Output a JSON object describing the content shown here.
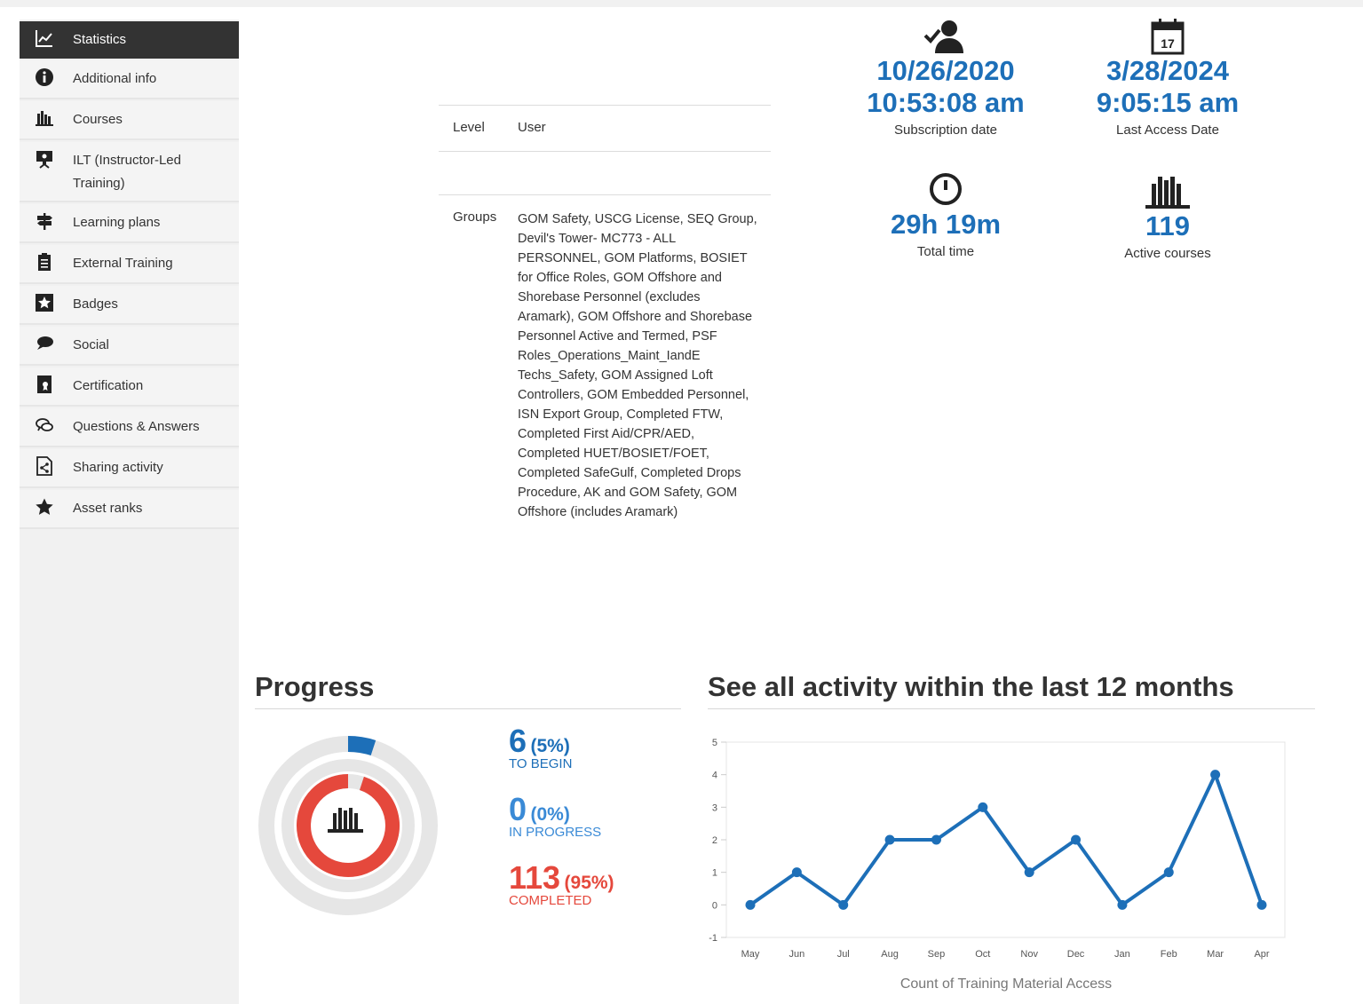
{
  "sidebar": {
    "items": [
      {
        "label": "Statistics",
        "icon": "chart-line-icon",
        "active": true
      },
      {
        "label": "Additional info",
        "icon": "info-icon"
      },
      {
        "label": "Courses",
        "icon": "courses-icon"
      },
      {
        "label": "ILT (Instructor-Led Training)",
        "icon": "presentation-icon"
      },
      {
        "label": "Learning plans",
        "icon": "signpost-icon"
      },
      {
        "label": "External Training",
        "icon": "clipboard-icon"
      },
      {
        "label": "Badges",
        "icon": "badge-star-icon"
      },
      {
        "label": "Social",
        "icon": "chat-bubble-icon"
      },
      {
        "label": "Certification",
        "icon": "certificate-icon"
      },
      {
        "label": "Questions & Answers",
        "icon": "qa-bubbles-icon"
      },
      {
        "label": "Sharing activity",
        "icon": "share-document-icon"
      },
      {
        "label": "Asset ranks",
        "icon": "star-icon"
      }
    ]
  },
  "info": {
    "level_label": "Level",
    "level_value": "User",
    "groups_label": "Groups",
    "groups_value": "GOM Safety, USCG License, SEQ Group, Devil's Tower- MC773 - ALL PERSONNEL, GOM Platforms, BOSIET for Office Roles, GOM Offshore and Shorebase Personnel (excludes Aramark), GOM Offshore and Shorebase Personnel Active and Termed, PSF Roles_Operations_Maint_IandE Techs_Safety, GOM Assigned Loft Controllers, GOM Embedded Personnel, ISN Export Group, Completed FTW, Completed First Aid/CPR/AED, Completed HUET/BOSIET/FOET, Completed SafeGulf, Completed Drops Procedure, AK and GOM Safety, GOM Offshore (includes Aramark)"
  },
  "stats": {
    "subscription": {
      "date": "10/26/2020",
      "time": "10:53:08 am",
      "caption": "Subscription date",
      "icon": "user-check-icon"
    },
    "last_access": {
      "date": "3/28/2024",
      "time": "9:05:15 am",
      "caption": "Last Access Date",
      "icon": "calendar-icon",
      "calendar_day": "17"
    },
    "total_time": {
      "value": "29h 19m",
      "caption": "Total time",
      "icon": "clock-icon"
    },
    "active_courses": {
      "value": "119",
      "caption": "Active courses",
      "icon": "books-icon"
    }
  },
  "progress": {
    "title": "Progress",
    "to_begin": {
      "count": "6",
      "pct": "(5%)",
      "label": "TO BEGIN",
      "fraction": 0.05
    },
    "in_progress": {
      "count": "0",
      "pct": "(0%)",
      "label": "IN PROGRESS",
      "fraction": 0.0
    },
    "completed": {
      "count": "113",
      "pct": "(95%)",
      "label": "COMPLETED",
      "fraction": 0.95
    },
    "colors": {
      "to_begin": "#1d6fb8",
      "in_progress": "#3a8ad6",
      "completed": "#e5483c",
      "track": "#e6e6e6"
    }
  },
  "activity": {
    "title": "See all activity within the last 12 months"
  },
  "chart_data": {
    "type": "line",
    "categories": [
      "May",
      "Jun",
      "Jul",
      "Aug",
      "Sep",
      "Oct",
      "Nov",
      "Dec",
      "Jan",
      "Feb",
      "Mar",
      "Apr"
    ],
    "values": [
      0,
      1,
      0,
      2,
      2,
      3,
      1,
      2,
      0,
      1,
      4,
      0
    ],
    "y_ticks": [
      "5",
      "4",
      "3",
      "2",
      "1",
      "0",
      "-1"
    ],
    "ylim": [
      -1,
      5
    ],
    "xlabel": "Count of Training Material Access",
    "ylabel": "",
    "title": "",
    "grid": false,
    "line_color": "#1d6fb8"
  }
}
